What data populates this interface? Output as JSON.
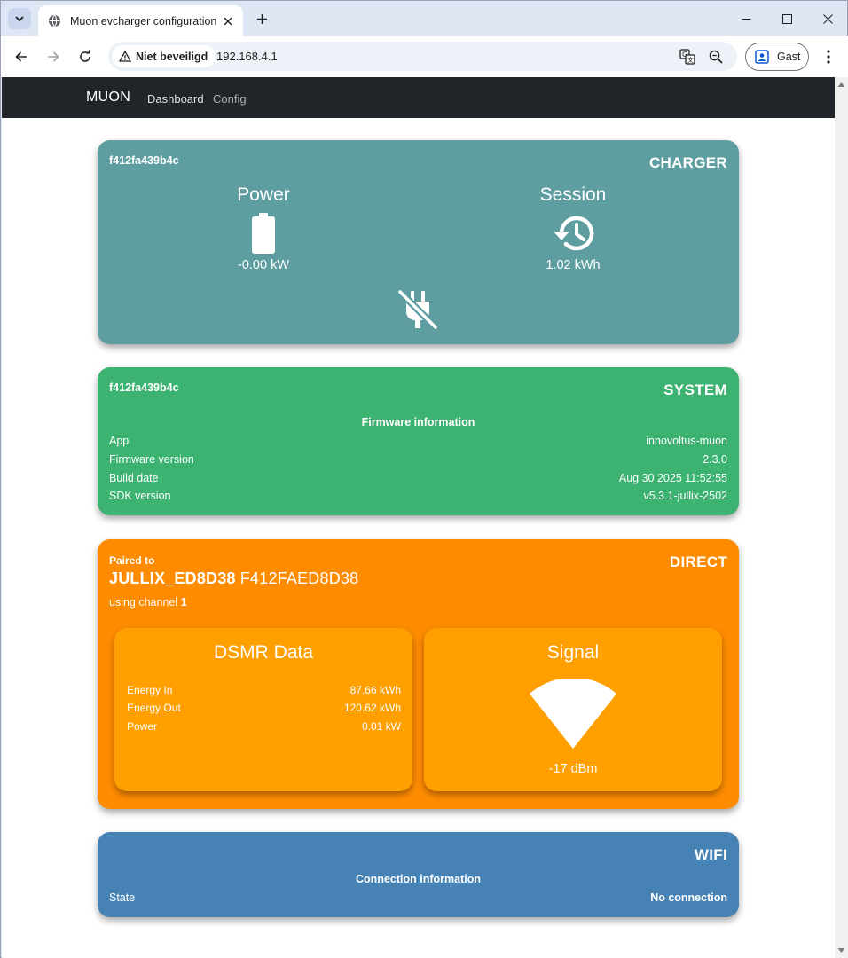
{
  "browser": {
    "tab_title": "Muon evcharger configuration",
    "security_label": "Niet beveiligd",
    "url": "192.168.4.1",
    "profile_label": "Gast"
  },
  "navbar": {
    "brand": "MUON",
    "links": [
      {
        "label": "Dashboard"
      },
      {
        "label": "Config"
      }
    ],
    "bg_color": "#212529"
  },
  "charger": {
    "id": "f412fa439b4c",
    "tag": "CHARGER",
    "color": "#5f9ea0",
    "power": {
      "title": "Power",
      "value": "-0.00 kW",
      "icon": "battery-icon"
    },
    "session": {
      "title": "Session",
      "value": "1.02 kWh",
      "icon": "history-icon"
    },
    "status_icon": "plug-off-icon"
  },
  "system": {
    "id": "f412fa439b4c",
    "tag": "SYSTEM",
    "color": "#3cb371",
    "heading": "Firmware information",
    "rows": [
      {
        "label": "App",
        "value": "innovoltus-muon"
      },
      {
        "label": "Firmware version",
        "value": "2.3.0"
      },
      {
        "label": "Build date",
        "value": "Aug 30 2025 11:52:55"
      },
      {
        "label": "SDK version",
        "value": "v5.3.1-jullix-2502"
      }
    ]
  },
  "direct": {
    "tag": "DIRECT",
    "color": "#ff8c00",
    "paired_label": "Paired to",
    "paired_name": "JULLIX_ED8D38",
    "paired_mac": "F412FAED8D38",
    "channel_prefix": "using channel",
    "channel": "1",
    "dsmr": {
      "title": "DSMR Data",
      "rows": [
        {
          "label": "Energy In",
          "value": "87.66 kWh"
        },
        {
          "label": "Energy Out",
          "value": "120.62 kWh"
        },
        {
          "label": "Power",
          "value": "0.01 kW"
        }
      ]
    },
    "signal": {
      "title": "Signal",
      "value": "-17 dBm",
      "icon": "wifi-signal-icon"
    }
  },
  "wifi": {
    "tag": "WIFI",
    "color": "#4682b4",
    "heading": "Connection information",
    "rows": [
      {
        "label": "State",
        "value": "No connection"
      }
    ]
  }
}
